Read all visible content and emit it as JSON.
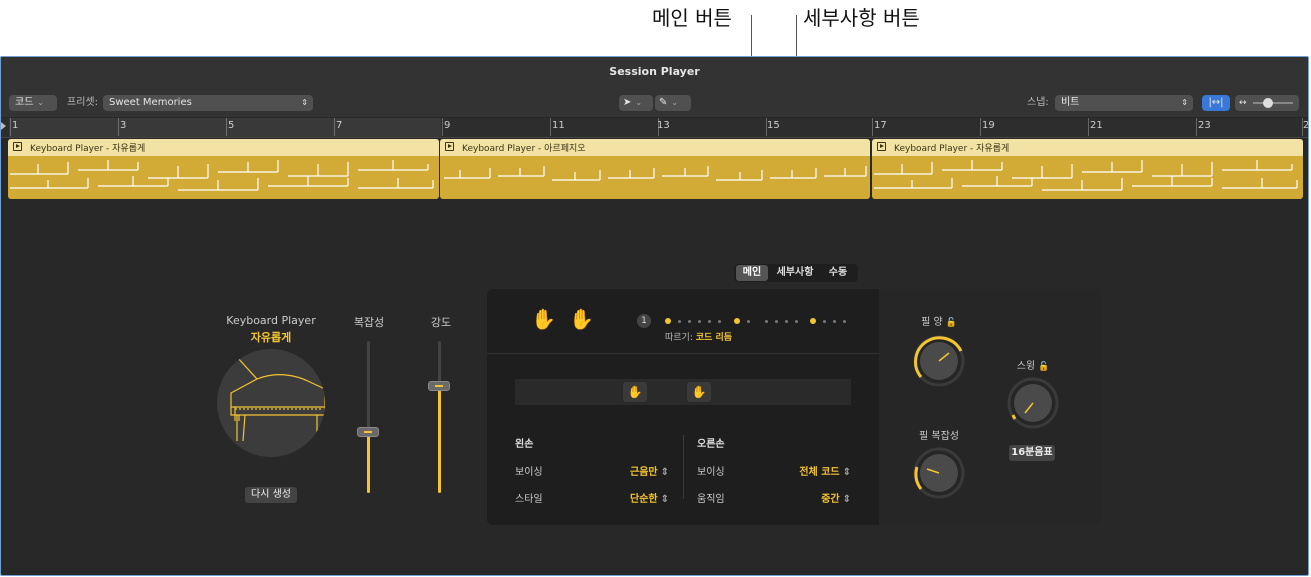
{
  "callouts": {
    "main_button": "메인 버튼",
    "details_button": "세부사항 버튼"
  },
  "window": {
    "title": "Session Player"
  },
  "toolbar": {
    "chord_menu": "코드",
    "preset_label": "프리셋:",
    "preset_value": "Sweet Memories",
    "snap_label": "스냅:",
    "snap_value": "비트"
  },
  "ruler": {
    "numbers": [
      "1",
      "3",
      "5",
      "7",
      "9",
      "11",
      "13",
      "15",
      "17",
      "19",
      "21",
      "23",
      "2"
    ]
  },
  "regions": [
    {
      "name": "Keyboard Player - 자유롭게"
    },
    {
      "name": "Keyboard Player - 아르페지오"
    },
    {
      "name": "Keyboard Player - 자유롭게"
    }
  ],
  "tabs": {
    "main": "메인",
    "details": "세부사항",
    "manual": "수동"
  },
  "player": {
    "name": "Keyboard Player",
    "style": "자유롭게",
    "regenerate": "다시 생성"
  },
  "sliders": {
    "complexity": {
      "label": "복잡성",
      "value": 0.4
    },
    "intensity": {
      "label": "강도",
      "value": 0.8
    }
  },
  "follow": {
    "label": "따르기:",
    "value": "코드 리듬",
    "badge": "1"
  },
  "hands": {
    "left": {
      "title": "왼손",
      "voicing_label": "보이싱",
      "voicing_value": "근음만",
      "style_label": "스타일",
      "style_value": "단순한"
    },
    "right": {
      "title": "오른손",
      "voicing_label": "보이싱",
      "voicing_value": "전체 코드",
      "movement_label": "움직임",
      "movement_value": "중간"
    }
  },
  "knobs": {
    "fill_amount": {
      "label": "필 양"
    },
    "fill_complexity": {
      "label": "필 복잡성"
    },
    "swing": {
      "label": "스윙",
      "button": "16분음표"
    }
  },
  "colors": {
    "accent": "#f4c531",
    "region": "#d2aa36",
    "background": "#282828",
    "selection": "#3a78d8"
  },
  "icons": [
    "chevron-down-icon",
    "pointer-tool-icon",
    "pencil-tool-icon",
    "snap-icon",
    "zoom-icon",
    "play-icon",
    "hand-icon",
    "lock-icon",
    "piano-icon"
  ]
}
